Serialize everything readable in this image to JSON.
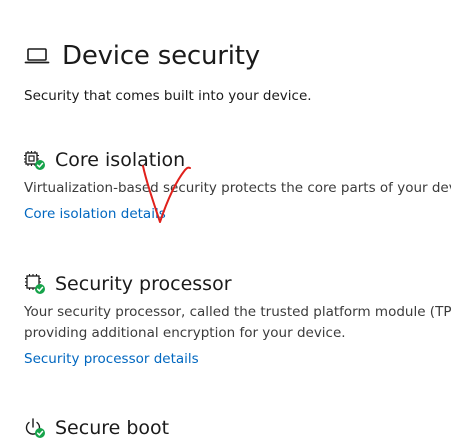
{
  "header": {
    "title": "Device security",
    "subtitle": "Security that comes built into your device.",
    "icon": "laptop-icon"
  },
  "sections": [
    {
      "icon": "core-isolation-icon",
      "title": "Core isolation",
      "description": "Virtualization-based security protects the core parts of your devic",
      "link": "Core isolation details"
    },
    {
      "icon": "security-processor-icon",
      "title": "Security processor",
      "description_lines": [
        "Your security processor, called the trusted platform module (TPM",
        "providing additional encryption for your device."
      ],
      "link": "Security processor details"
    },
    {
      "icon": "secure-boot-icon",
      "title": "Secure boot"
    }
  ],
  "colors": {
    "link": "#0067c0",
    "status_ok": "#16a34a",
    "annotation": "#e0201b"
  }
}
